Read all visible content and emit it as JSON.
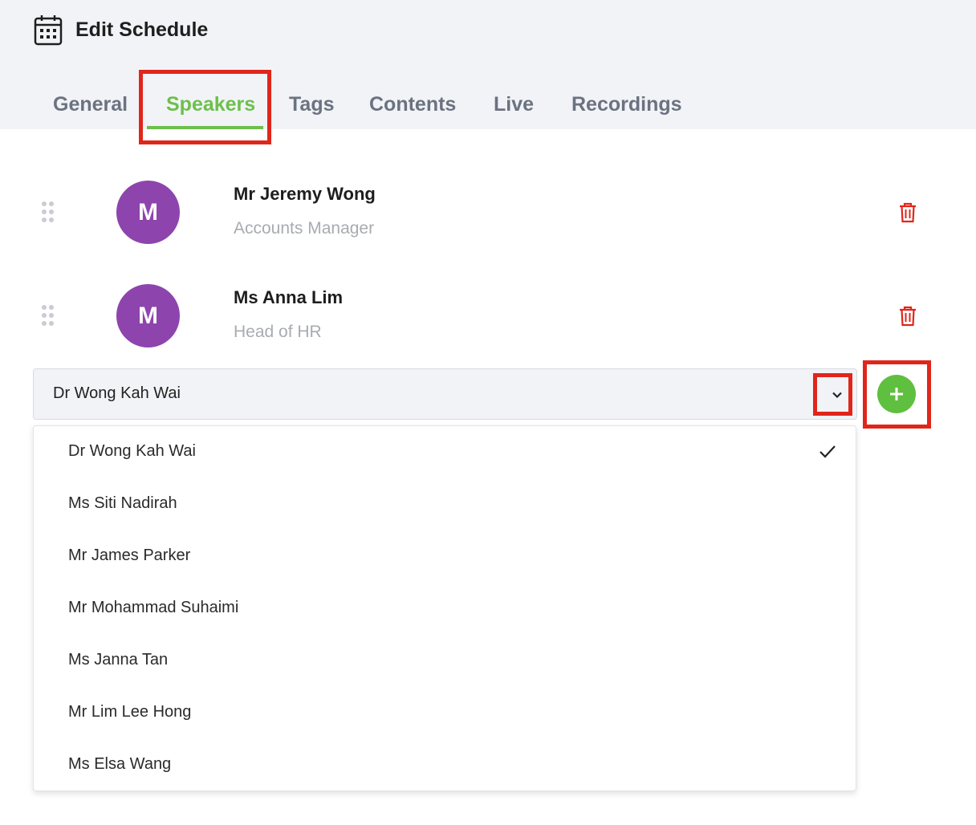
{
  "header": {
    "title": "Edit Schedule",
    "icon": "calendar-icon"
  },
  "tabs": [
    {
      "label": "General",
      "active": false
    },
    {
      "label": "Speakers",
      "active": true
    },
    {
      "label": "Tags",
      "active": false
    },
    {
      "label": "Contents",
      "active": false
    },
    {
      "label": "Live",
      "active": false
    },
    {
      "label": "Recordings",
      "active": false
    }
  ],
  "speakers": [
    {
      "initial": "M",
      "name": "Mr Jeremy Wong",
      "role": "Accounts Manager"
    },
    {
      "initial": "M",
      "name": "Ms Anna Lim",
      "role": "Head of HR"
    }
  ],
  "speaker_select": {
    "value": "Dr Wong Kah Wai",
    "options": [
      {
        "label": "Dr Wong Kah Wai",
        "selected": true
      },
      {
        "label": "Ms Siti Nadirah",
        "selected": false
      },
      {
        "label": "Mr James Parker",
        "selected": false
      },
      {
        "label": "Mr Mohammad Suhaimi",
        "selected": false
      },
      {
        "label": "Ms Janna Tan",
        "selected": false
      },
      {
        "label": "Mr Lim Lee Hong",
        "selected": false
      },
      {
        "label": "Ms Elsa Wang",
        "selected": false
      }
    ]
  },
  "colors": {
    "accent": "#6cc04a",
    "add_button": "#5fbf3f",
    "avatar": "#8e44ad",
    "delete": "#e0261b",
    "highlight": "#e0261b",
    "header_bg": "#f2f3f7"
  }
}
